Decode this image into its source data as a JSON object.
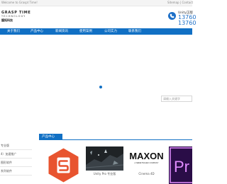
{
  "topbar": {
    "left_text": "Welcome to Graspt Time!",
    "right_text": "Sitemap | Contact"
  },
  "logo": {
    "line1": "GRASP TIME",
    "line2": "TECHNOLOGY",
    "line3": "握拓科技"
  },
  "header": {
    "phone_label": "Unity正版",
    "phone1": "13760",
    "phone2": "13760"
  },
  "nav": {
    "items": [
      {
        "label": "关于我们"
      },
      {
        "label": "产品中心"
      },
      {
        "label": "新闻资讯"
      },
      {
        "label": "使用案例"
      },
      {
        "label": "公司实力"
      },
      {
        "label": "联系我们"
      }
    ]
  },
  "search": {
    "placeholder": "请输入关键字"
  },
  "sidebar": {
    "items": [
      {
        "label": "专业版"
      },
      {
        "label": "4）加速推广"
      },
      {
        "label": "图形软件"
      },
      {
        "label": "系列软件"
      }
    ]
  },
  "products": {
    "section_title": "产品中心",
    "items": [
      {
        "name": "Substance",
        "caption": ""
      },
      {
        "name": "Unity Pro",
        "caption": "Unity Pro 专业版"
      },
      {
        "name": "Maxon",
        "caption": "Cinema 4D"
      },
      {
        "name": "Premiere Pro",
        "caption": ""
      }
    ],
    "maxon_logo_text": "MAXON",
    "maxon_tagline": "A NEMETSCHEK COMPANY",
    "pr_logo_text": "Pr"
  },
  "colors": {
    "brand_blue": "#1170c4",
    "substance_orange": "#e8542f",
    "premiere_purple": "#2a0d47",
    "premiere_accent": "#e28cff"
  }
}
